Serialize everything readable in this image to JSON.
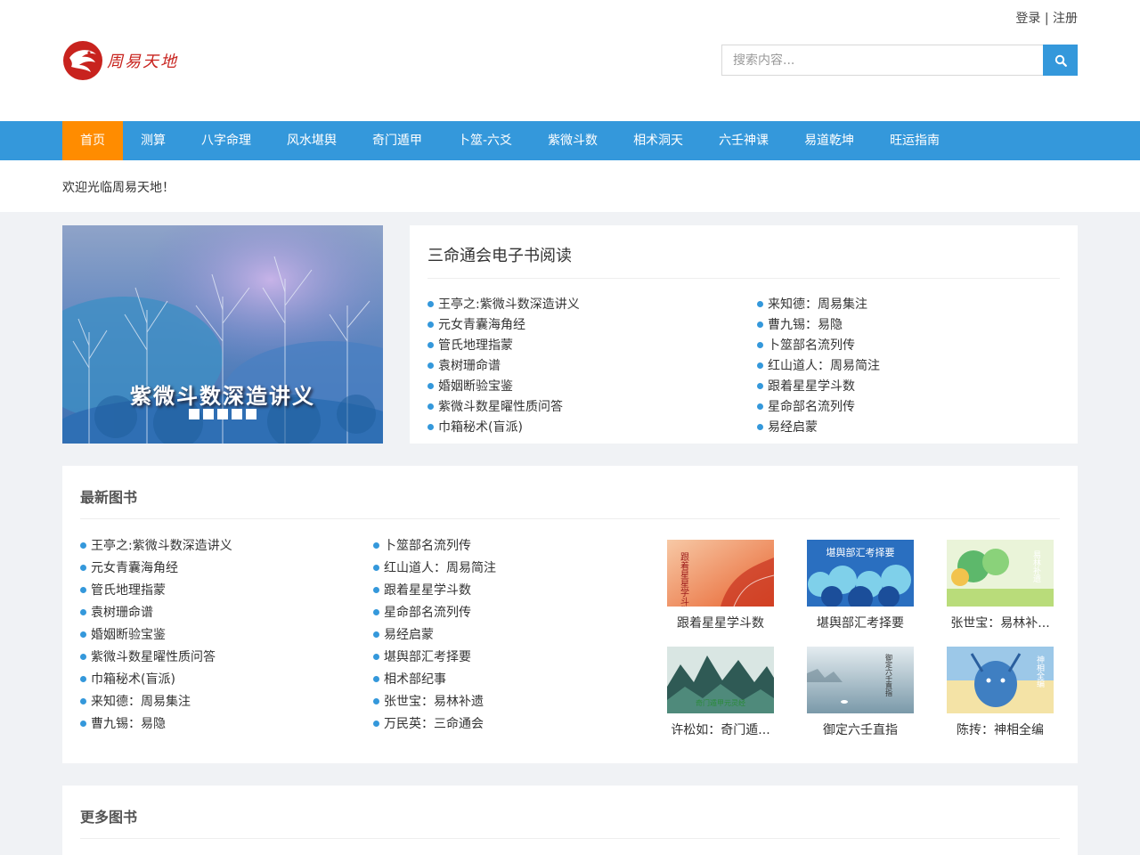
{
  "header": {
    "login": "登录",
    "separator": "|",
    "register": "注册",
    "logo_text": "周易天地",
    "search_placeholder": "搜索内容..."
  },
  "nav": {
    "items": [
      "首页",
      "测算",
      "八字命理",
      "风水堪舆",
      "奇门遁甲",
      "卜筮-六爻",
      "紫微斗数",
      "相术洞天",
      "六壬神课",
      "易道乾坤",
      "旺运指南"
    ],
    "active_index": 0
  },
  "welcome": "欢迎光临周易天地！",
  "banner": {
    "caption": "紫微斗数深造讲义",
    "slide_count": 5
  },
  "ebooks": {
    "title": "三命通会电子书阅读",
    "left": [
      "王亭之:紫微斗数深造讲义",
      "元女青囊海角经",
      "管氏地理指蒙",
      "袁树珊命谱",
      "婚姻断验宝鉴",
      "紫微斗数星曜性质问答",
      "巾箱秘术(盲派)"
    ],
    "right": [
      "来知德：周易集注",
      "曹九锡：易隐",
      "卜筮部名流列传",
      "红山道人：周易简注",
      "跟着星星学斗数",
      "星命部名流列传",
      "易经启蒙"
    ]
  },
  "latest": {
    "title": "最新图书",
    "col1": [
      "王亭之:紫微斗数深造讲义",
      "元女青囊海角经",
      "管氏地理指蒙",
      "袁树珊命谱",
      "婚姻断验宝鉴",
      "紫微斗数星曜性质问答",
      "巾箱秘术(盲派)",
      "来知德：周易集注",
      "曹九锡：易隐"
    ],
    "col2": [
      "卜筮部名流列传",
      "红山道人：周易简注",
      "跟着星星学斗数",
      "星命部名流列传",
      "易经启蒙",
      "堪舆部汇考择要",
      "相术部纪事",
      "张世宝：易林补遗",
      "万民英：三命通会"
    ],
    "thumbs": [
      {
        "caption": "跟着星星学斗数",
        "cover_text": "跟着星星学斗数"
      },
      {
        "caption": "堪舆部汇考择要",
        "cover_text": "堪舆部汇考择要"
      },
      {
        "caption": "张世宝：易林补...",
        "cover_text": "易林补遗"
      },
      {
        "caption": "许松如：奇门遁...",
        "cover_text": "奇门遁甲元灵经"
      },
      {
        "caption": "御定六壬直指",
        "cover_text": "御定六壬直指"
      },
      {
        "caption": "陈抟：神相全编",
        "cover_text": "神相全编"
      }
    ]
  },
  "more": {
    "title": "更多图书"
  },
  "colors": {
    "nav_bg": "#3498db",
    "nav_active": "#ff8c00",
    "brand_red": "#c8231e",
    "page_bg": "#f0f2f5"
  }
}
